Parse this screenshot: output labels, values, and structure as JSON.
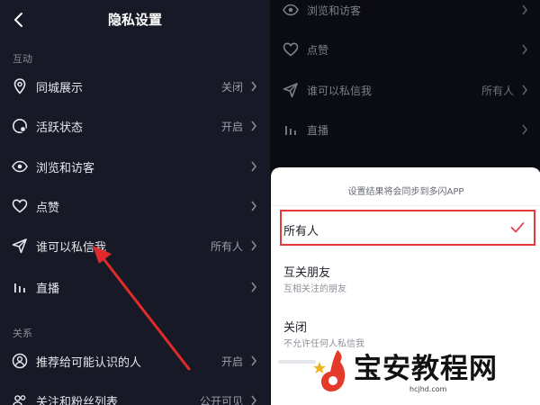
{
  "left": {
    "title": "隐私设置",
    "sections": [
      {
        "label": "互动"
      },
      {
        "label": "关系"
      }
    ],
    "rows": [
      {
        "label": "同城展示",
        "value": "关闭",
        "icon": "location-pin-icon"
      },
      {
        "label": "活跃状态",
        "value": "开启",
        "icon": "activity-status-icon"
      },
      {
        "label": "浏览和访客",
        "value": "",
        "icon": "eye-icon"
      },
      {
        "label": "点赞",
        "value": "",
        "icon": "heart-icon"
      },
      {
        "label": "谁可以私信我",
        "value": "所有人",
        "icon": "paper-plane-icon"
      },
      {
        "label": "直播",
        "value": "",
        "icon": "live-bars-icon"
      },
      {
        "label": "推荐给可能认识的人",
        "value": "开启",
        "icon": "person-icon"
      },
      {
        "label": "关注和粉丝列表",
        "value": "公开可见",
        "icon": "people-icon"
      }
    ]
  },
  "right": {
    "bg_rows": [
      {
        "label": "浏览和访客",
        "value": "",
        "icon": "eye-icon"
      },
      {
        "label": "点赞",
        "value": "",
        "icon": "heart-icon"
      },
      {
        "label": "谁可以私信我",
        "value": "所有人",
        "icon": "paper-plane-icon"
      },
      {
        "label": "直播",
        "value": "",
        "icon": "live-bars-icon"
      }
    ],
    "sheet": {
      "hint": "设置结果将会同步到多闪APP",
      "options": [
        {
          "label": "所有人",
          "sub": "",
          "selected": true
        },
        {
          "label": "互关朋友",
          "sub": "互相关注的朋友",
          "selected": false
        },
        {
          "label": "关闭",
          "sub": "不允许任何人私信我",
          "selected": false
        }
      ]
    }
  },
  "watermark": {
    "text": "宝安教程网",
    "url": "hcjhd.com"
  },
  "colors": {
    "highlight": "#e83a3a",
    "check": "#e8435a",
    "arrow": "#e12b2b",
    "background": "#171a26"
  }
}
